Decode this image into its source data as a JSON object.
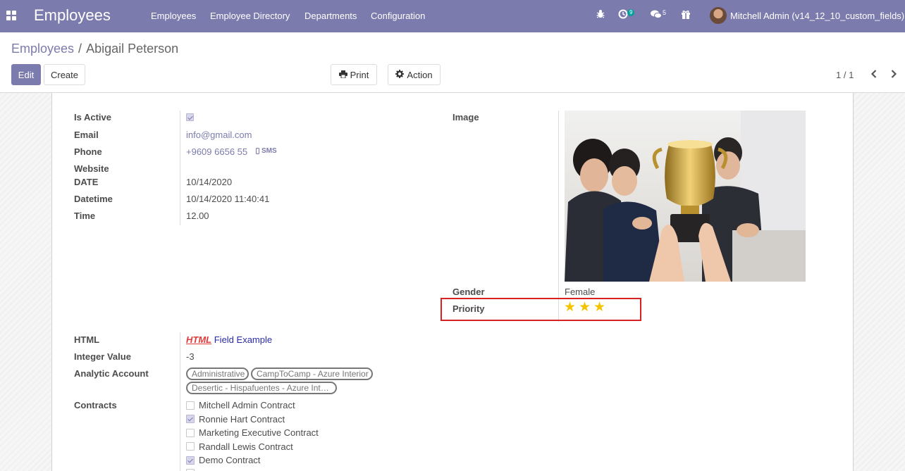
{
  "navbar": {
    "brand": "Employees",
    "menu": [
      "Employees",
      "Employee Directory",
      "Departments",
      "Configuration"
    ],
    "activity_count": "9",
    "message_count": "5",
    "user": "Mitchell Admin (v14_12_10_custom_fields)"
  },
  "breadcrumb": {
    "parent": "Employees",
    "separator": "/",
    "current": "Abigail Peterson"
  },
  "buttons": {
    "edit": "Edit",
    "create": "Create",
    "print": "Print",
    "action": "Action"
  },
  "pager": {
    "value": "1 / 1"
  },
  "form": {
    "is_active_label": "Is Active",
    "email_label": "Email",
    "email": "info@gmail.com",
    "phone_label": "Phone",
    "phone": "+9609 6656 55",
    "sms": "SMS",
    "website_label": "Website",
    "date_label": "DATE",
    "date": "10/14/2020",
    "datetime_label": "Datetime",
    "datetime": "10/14/2020 11:40:41",
    "time_label": "Time",
    "time": "12.00",
    "image_label": "Image",
    "gender_label": "Gender",
    "gender": "Female",
    "priority_label": "Priority",
    "priority": 3,
    "priority_max": 3,
    "html_label": "HTML",
    "html_part1": "HTML",
    "html_part2": "Field Example",
    "integer_label": "Integer Value",
    "integer": "-3",
    "analytic_label": "Analytic Account",
    "analytic_tags": [
      "Administrative",
      "CampToCamp - Azure Interior",
      "Desertic - Hispafuentes - Azure Int…"
    ],
    "contracts_label": "Contracts",
    "contracts": [
      {
        "name": "Mitchell Admin Contract",
        "checked": false
      },
      {
        "name": "Ronnie Hart Contract",
        "checked": true
      },
      {
        "name": "Marketing Executive Contract",
        "checked": false
      },
      {
        "name": "Randall Lewis Contract",
        "checked": false
      },
      {
        "name": "Demo Contract",
        "checked": true
      }
    ]
  },
  "colors": {
    "brand": "#7c7bad",
    "star": "#f3c300",
    "highlight": "#d62222"
  }
}
